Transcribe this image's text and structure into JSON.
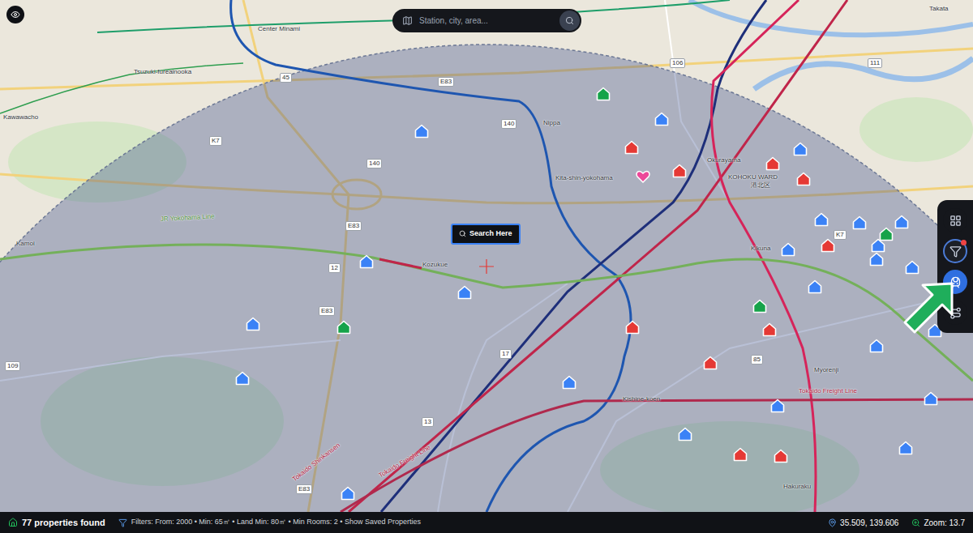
{
  "search": {
    "placeholder": "Station, city, area..."
  },
  "search_here_button": {
    "label": "Search Here"
  },
  "toolbar": {
    "buttons": [
      {
        "kind": "grid",
        "selected": false,
        "badge": false
      },
      {
        "kind": "filter",
        "selected": false,
        "badge": true
      },
      {
        "kind": "transit",
        "selected": true,
        "badge": false
      },
      {
        "kind": "routes",
        "selected": false,
        "badge": false
      }
    ]
  },
  "map": {
    "labels": [
      {
        "text": "Takata",
        "kind": "place"
      },
      {
        "text": "Center Minami",
        "kind": "place"
      },
      {
        "text": "Tsuzuki-fureainooka",
        "kind": "place"
      },
      {
        "text": "Kawawacho",
        "kind": "place"
      },
      {
        "text": "Nippa",
        "kind": "place"
      },
      {
        "text": "Kita-shin-yokohama",
        "kind": "place"
      },
      {
        "text": "Okurayama",
        "kind": "place"
      },
      {
        "text": "KOHOKU WARD",
        "kind": "place"
      },
      {
        "text": "港北区",
        "kind": "place"
      },
      {
        "text": "Kikuna",
        "kind": "place"
      },
      {
        "text": "Kozukue",
        "kind": "place"
      },
      {
        "text": "Kamoi",
        "kind": "place"
      },
      {
        "text": "Myorenji",
        "kind": "place"
      },
      {
        "text": "Kishine-koen",
        "kind": "place"
      },
      {
        "text": "Hakuraku",
        "kind": "place"
      },
      {
        "text": "JR Yokohama Line",
        "kind": "rail",
        "color": "#4f8f38"
      },
      {
        "text": "Tokaido Shinkansen",
        "kind": "rail",
        "color": "#b0213f"
      },
      {
        "text": "Tokaido Freight Line",
        "kind": "rail",
        "color": "#b0213f"
      },
      {
        "text": "Tokaido Freight Line",
        "kind": "rail",
        "color": "#b0213f"
      },
      {
        "text": "45",
        "kind": "road"
      },
      {
        "text": "E83",
        "kind": "road"
      },
      {
        "text": "140",
        "kind": "road"
      },
      {
        "text": "K7",
        "kind": "road"
      },
      {
        "text": "140",
        "kind": "road"
      },
      {
        "text": "E83",
        "kind": "road"
      },
      {
        "text": "12",
        "kind": "road"
      },
      {
        "text": "E83",
        "kind": "road"
      },
      {
        "text": "106",
        "kind": "road"
      },
      {
        "text": "111",
        "kind": "road"
      },
      {
        "text": "K7",
        "kind": "road"
      },
      {
        "text": "17",
        "kind": "road"
      },
      {
        "text": "85",
        "kind": "road"
      },
      {
        "text": "13",
        "kind": "road"
      },
      {
        "text": "109",
        "kind": "road"
      },
      {
        "text": "E83",
        "kind": "road"
      }
    ],
    "pins": [
      {
        "kind": "house",
        "color": "#16a34a"
      },
      {
        "kind": "house",
        "color": "#3b82f6"
      },
      {
        "kind": "house",
        "color": "#3b82f6"
      },
      {
        "kind": "house",
        "color": "#3b82f6"
      },
      {
        "kind": "house",
        "color": "#e53935"
      },
      {
        "kind": "house",
        "color": "#e53935"
      },
      {
        "kind": "heart",
        "color": "#ec4899"
      },
      {
        "kind": "house",
        "color": "#e53935"
      },
      {
        "kind": "house",
        "color": "#e53935"
      },
      {
        "kind": "house",
        "color": "#3b82f6"
      },
      {
        "kind": "house",
        "color": "#3b82f6"
      },
      {
        "kind": "house",
        "color": "#3b82f6"
      },
      {
        "kind": "house",
        "color": "#16a34a"
      },
      {
        "kind": "house",
        "color": "#e53935"
      },
      {
        "kind": "house",
        "color": "#3b82f6"
      },
      {
        "kind": "house",
        "color": "#3b82f6"
      },
      {
        "kind": "house",
        "color": "#3b82f6"
      },
      {
        "kind": "house",
        "color": "#3b82f6"
      },
      {
        "kind": "house",
        "color": "#3b82f6"
      },
      {
        "kind": "house",
        "color": "#3b82f6"
      },
      {
        "kind": "house",
        "color": "#3b82f6"
      },
      {
        "kind": "house",
        "color": "#3b82f6"
      },
      {
        "kind": "house",
        "color": "#16a34a"
      },
      {
        "kind": "house",
        "color": "#3b82f6"
      },
      {
        "kind": "house",
        "color": "#16a34a"
      },
      {
        "kind": "house",
        "color": "#e53935"
      },
      {
        "kind": "house",
        "color": "#e53935"
      },
      {
        "kind": "house",
        "color": "#3b82f6"
      },
      {
        "kind": "house",
        "color": "#e53935"
      },
      {
        "kind": "house",
        "color": "#3b82f6"
      },
      {
        "kind": "house",
        "color": "#3b82f6"
      },
      {
        "kind": "house",
        "color": "#3b82f6"
      },
      {
        "kind": "house",
        "color": "#3b82f6"
      },
      {
        "kind": "house",
        "color": "#3b82f6"
      },
      {
        "kind": "house",
        "color": "#e53935"
      },
      {
        "kind": "house",
        "color": "#e53935"
      },
      {
        "kind": "house",
        "color": "#3b82f6"
      },
      {
        "kind": "house",
        "color": "#3b82f6"
      }
    ]
  },
  "status_bar": {
    "count": "77 properties found",
    "filters": "Filters: From: 2000 • Min: 65㎡ • Land Min: 80㎡ • Min Rooms: 2 • Show Saved Properties",
    "coordinates": "35.509, 139.606",
    "zoom": "Zoom: 13.7"
  }
}
